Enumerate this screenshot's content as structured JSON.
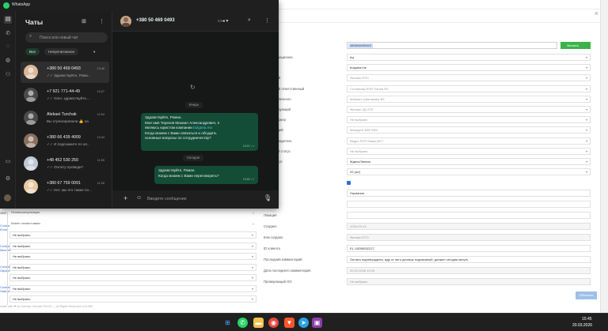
{
  "window": {
    "title": "WhatsApp"
  },
  "rail": {
    "icons": [
      "chats-icon",
      "calls-icon",
      "status-icon",
      "channels-icon",
      "communities-icon",
      "media-icon",
      "settings-icon"
    ]
  },
  "chat_list": {
    "title": "Чаты",
    "search_placeholder": "Поиск или новый чат",
    "filters": [
      "Все",
      "Непрочитанное",
      "▾"
    ],
    "chats": [
      {
        "name": "+380 50 469 0493",
        "time": "13:45",
        "preview": "✓✓ Здравствуйте, Рома...",
        "avatar_color": "#d9b89a"
      },
      {
        "name": "+7 921 771-44-49",
        "time": "13:27",
        "preview": "✓✓ Олег, здравствуйте....",
        "avatar_color": "#4a4a4a"
      },
      {
        "name": "Alekaei Turchak",
        "time": "12:54",
        "preview": "Вы отреагировали 👍 на",
        "avatar_color": "#4a4a4a"
      },
      {
        "name": "+380 66 439 4009",
        "time": "12:34",
        "preview": "✓✓ И подскажите по ап...",
        "avatar_color": "#8a6e5c"
      },
      {
        "name": "+48 452 530 250",
        "time": "11:59",
        "preview": "✓✓ Оплату проведи?",
        "avatar_color": "#bfc8d6"
      },
      {
        "name": "+380 67 759 0091",
        "time": "11:39",
        "preview": "✓✓ Нет, мы его также по...",
        "avatar_color": "#e8c9a2"
      }
    ]
  },
  "conversation": {
    "contact": "+380 50 469 0493",
    "day_1": "Вчера",
    "day_2": "Сегодня",
    "msg_1_lines": [
      "Здравствуйте, Роман.",
      "Мое имя Терехов Михаил Александрович, я",
      "являюсь юристом компании ",
      "Когда можем с Вами связаться и обсудить",
      "основные вопросы по сотрудничеству?"
    ],
    "msg_1_link": "bulgaria.mo",
    "msg_1_time": "15:19 ✓✓",
    "msg_2_lines": [
      "Здравствуйте, Роман.",
      "Когда можем с Вами переговорить?"
    ],
    "msg_2_time": "13:45 ✓✓",
    "compose_placeholder": "Введите сообщение"
  },
  "crm": {
    "phone_value": "380504690493",
    "call_label": "Звонить",
    "fields": [
      {
        "label": "...лизационна",
        "value": "Ац"
      },
      {
        "label": "...т",
        "value": "bulgaria.me"
      },
      {
        "label": "...ный",
        "value": "Филиал ЕТО"
      },
      {
        "label": "...ный ответственный",
        "value": "Сотникова РОП Панов ЯС"
      },
      {
        "label": "...тственного",
        "value": "Майлинг (Шалиман) ВЗ"
      },
      {
        "label": "...ледующий",
        "value": "Филиал ЗД ХТЕ"
      },
      {
        "label": "...неджер",
        "value": "Не выбрано"
      },
      {
        "label": "...ющий",
        "value": "Макфуоп ЗИЕ БЕБ"
      },
      {
        "label": "...ководитель",
        "value": "Ведро РОП Маша БЕТ"
      },
      {
        "label": "...ний статус",
        "value": "Не выбрано"
      },
      {
        "label": "...татус",
        "value": "Ждать/Звонок"
      },
      {
        "label": "",
        "value": "20 (шт)"
      }
    ],
    "lower_fields": [
      {
        "label": "...нента",
        "value": "Германия"
      },
      {
        "label": "...нта",
        "value": ""
      },
      {
        "label": "Локация",
        "value": ""
      },
      {
        "label": "Создано",
        "value": "2026-03-13"
      },
      {
        "label": "Кем создано",
        "value": "Филиал ЕТО"
      },
      {
        "label": "ID клиента",
        "value": "EL-18208532227"
      },
      {
        "label": "Последний комментарий",
        "value": "Оплата подтверждена, жду от него договор подписаный, должен сегодня кинуть"
      },
      {
        "label": "Дата последнего комментария",
        "value": "20.03.2026 11:06"
      },
      {
        "label": "Проверяющий ОО",
        "value": "Не выбрано"
      }
    ],
    "side_labels": [
      {
        "label": "Полная консультация",
        "value": ""
      },
      {
        "label": "Клиент оплатил аванс",
        "value": ""
      },
      {
        "label": "",
        "value": "Не выбрано"
      },
      {
        "label": "",
        "value": "Не выбрано"
      },
      {
        "label": "",
        "value": "Не выбрано"
      },
      {
        "label": "",
        "value": "Не выбрано"
      },
      {
        "label": "",
        "value": "Не выбрано"
      },
      {
        "label": "",
        "value": "Не выбрано"
      },
      {
        "label": "",
        "value": "Не выбрано"
      }
    ],
    "side_contacts": [
      "Contact\nЮлия",
      "Contact\nЕвгений",
      "Contact\nЛарина",
      "Contact\nНикита"
    ],
    "side_number": "3600",
    "save_label": "Обновить",
    "footer": "made with ❤ by Xsender Xsender RUVO — All Rights Reserved v2.0.550"
  },
  "taskbar": {
    "time": "15:45",
    "date": "20.03.2026",
    "apps": [
      "windows-start-icon",
      "whatsapp-app-icon",
      "explorer-app-icon",
      "chrome-app-icon",
      "brave-app-icon",
      "telegram-app-icon",
      "app-icon"
    ]
  },
  "colors": {
    "wa_bg": "#1f1f1f",
    "bubble": "#144d37",
    "accent_green": "#25d366",
    "crm_call": "#3cb34a",
    "crm_save": "#9ebfe8",
    "taskbar": "#202020"
  }
}
